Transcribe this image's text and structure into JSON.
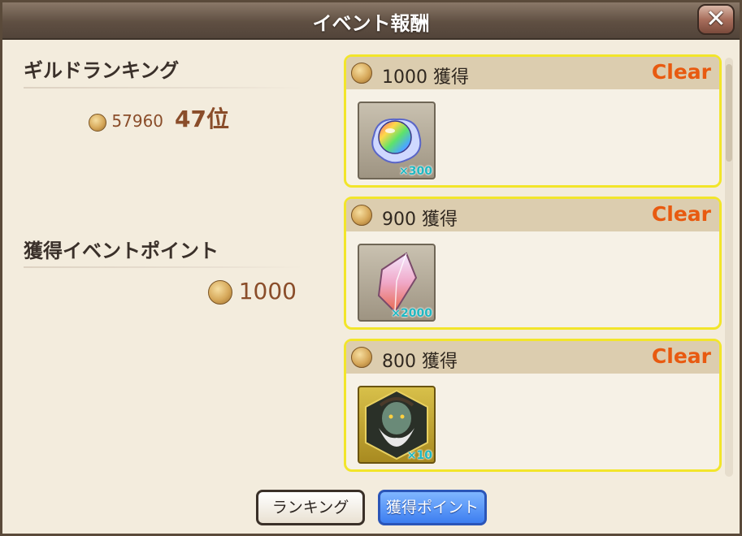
{
  "window": {
    "title": "イベント報酬",
    "close_label": "✕"
  },
  "guild_ranking": {
    "heading": "ギルドランキング",
    "points": "57960",
    "rank": "47位"
  },
  "event_points": {
    "heading": "獲得イベントポイント",
    "value": "1000"
  },
  "rewards": [
    {
      "label": "1000 獲得",
      "status": "Clear",
      "item_icon": "rainbow-orb-icon",
      "quantity": "×300"
    },
    {
      "label": "900 獲得",
      "status": "Clear",
      "item_icon": "crystal-shard-icon",
      "quantity": "×2000"
    },
    {
      "label": "800 獲得",
      "status": "Clear",
      "item_icon": "character-portrait-icon",
      "quantity": "×10"
    }
  ],
  "buttons": {
    "ranking": "ランキング",
    "points": "獲得ポイント"
  },
  "colors": {
    "accent_clear": "#e85a10",
    "card_border": "#f2e52a",
    "primary_button": "#3d7ef0"
  }
}
